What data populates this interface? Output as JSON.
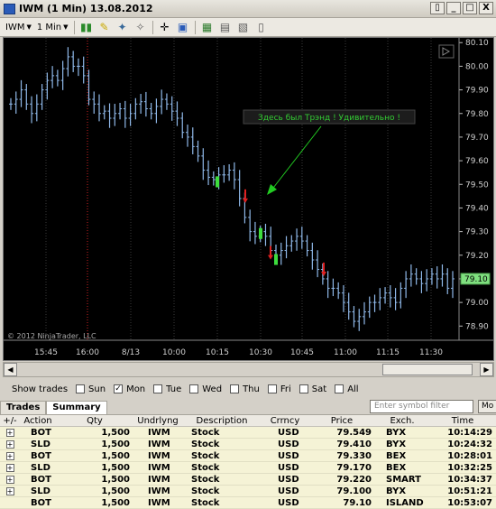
{
  "window": {
    "title": "IWM (1 Min)  13.08.2012",
    "btn_min": "_",
    "btn_max": "□",
    "btn_close": "X",
    "btn_restore": "▯"
  },
  "toolbar": {
    "instrument": "IWM",
    "interval": "1 Min",
    "icons": [
      "bars-icon",
      "pencil-icon",
      "drawing-tools-icon",
      "zoom-icon",
      "crosshair-icon",
      "magnifier-icon",
      "indicators-icon",
      "strategies-icon",
      "chart-properties-icon",
      "data-box-icon"
    ]
  },
  "chart": {
    "copyright": "© 2012 NinjaTrader, LLC",
    "annotation": "Здесь был Трэнд ! Удивительно !",
    "current_price": "79.10",
    "y_ticks": [
      "80.10",
      "80.00",
      "79.90",
      "79.80",
      "79.70",
      "79.60",
      "79.50",
      "79.40",
      "79.30",
      "79.20",
      "79.10",
      "79.00",
      "78.90"
    ],
    "x_ticks": [
      "15:45",
      "16:00",
      "8/13",
      "10:00",
      "10:15",
      "10:30",
      "10:45",
      "11:00",
      "11:15",
      "11:30"
    ],
    "colors": {
      "background": "#000000",
      "up_bar": "#8fb8e8",
      "down_bar": "#8fb8e8",
      "buy_marker": "#3ddc3d",
      "sell_marker": "#e02020",
      "annotation_text": "#33cc33",
      "arrow": "#22cc22",
      "session_break": "#cc2222"
    }
  },
  "chart_data": {
    "type": "ohlc",
    "instrument": "IWM",
    "interval": "1 Min",
    "y_range": [
      78.84,
      80.12
    ],
    "closes": [
      79.84,
      79.86,
      79.9,
      79.84,
      79.8,
      79.84,
      79.9,
      79.94,
      79.96,
      79.94,
      79.99,
      80.04,
      80.0,
      80.0,
      79.96,
      79.86,
      79.84,
      79.8,
      79.81,
      79.78,
      79.8,
      79.82,
      79.78,
      79.8,
      79.84,
      79.85,
      79.82,
      79.8,
      79.83,
      79.86,
      79.84,
      79.81,
      79.78,
      79.72,
      79.7,
      79.66,
      79.62,
      79.56,
      79.53,
      79.52,
      79.54,
      79.54,
      79.56,
      79.52,
      79.44,
      79.36,
      79.3,
      79.28,
      79.3,
      79.28,
      79.22,
      79.2,
      79.22,
      79.24,
      79.26,
      79.28,
      79.26,
      79.22,
      79.18,
      79.14,
      79.1,
      79.06,
      79.06,
      79.04,
      79.0,
      78.96,
      78.92,
      78.94,
      78.96,
      79.0,
      79.0,
      79.02,
      79.04,
      79.02,
      79.0,
      79.06,
      79.1,
      79.12,
      79.1,
      79.08,
      79.1,
      79.12,
      79.1,
      79.12,
      79.06,
      79.1
    ],
    "trades": [
      {
        "action": "BOT",
        "price": 79.549,
        "time": "10:14:29"
      },
      {
        "action": "SLD",
        "price": 79.41,
        "time": "10:24:32"
      },
      {
        "action": "BOT",
        "price": 79.33,
        "time": "10:28:01"
      },
      {
        "action": "SLD",
        "price": 79.17,
        "time": "10:32:25"
      },
      {
        "action": "BOT",
        "price": 79.22,
        "time": "10:34:37"
      },
      {
        "action": "SLD",
        "price": 79.1,
        "time": "10:51:21"
      }
    ]
  },
  "show_trades": {
    "label": "Show trades",
    "days": [
      {
        "name": "Sun",
        "checked": false
      },
      {
        "name": "Mon",
        "checked": true
      },
      {
        "name": "Tue",
        "checked": false
      },
      {
        "name": "Wed",
        "checked": false
      },
      {
        "name": "Thu",
        "checked": false
      },
      {
        "name": "Fri",
        "checked": false
      },
      {
        "name": "Sat",
        "checked": false
      },
      {
        "name": "All",
        "checked": false
      }
    ]
  },
  "tabs": [
    {
      "label": "Trades"
    },
    {
      "label": "Summary"
    }
  ],
  "filter": {
    "placeholder": "Enter symbol filter"
  },
  "more_button": "Mo",
  "grid": {
    "headers": [
      "+/-",
      "Action",
      "Qty",
      "Undrlyng",
      "Description",
      "Crrncy",
      "Price",
      "Exch.",
      "Time"
    ],
    "rows": [
      {
        "expand": "+",
        "action": "BOT",
        "qty": "1,500",
        "und": "IWM",
        "desc": "Stock",
        "cur": "USD",
        "price": "79.549",
        "exch": "BYX",
        "time": "10:14:29"
      },
      {
        "expand": "+",
        "action": "SLD",
        "qty": "1,500",
        "und": "IWM",
        "desc": "Stock",
        "cur": "USD",
        "price": "79.410",
        "exch": "BYX",
        "time": "10:24:32"
      },
      {
        "expand": "+",
        "action": "BOT",
        "qty": "1,500",
        "und": "IWM",
        "desc": "Stock",
        "cur": "USD",
        "price": "79.330",
        "exch": "BEX",
        "time": "10:28:01"
      },
      {
        "expand": "+",
        "action": "SLD",
        "qty": "1,500",
        "und": "IWM",
        "desc": "Stock",
        "cur": "USD",
        "price": "79.170",
        "exch": "BEX",
        "time": "10:32:25"
      },
      {
        "expand": "+",
        "action": "BOT",
        "qty": "1,500",
        "und": "IWM",
        "desc": "Stock",
        "cur": "USD",
        "price": "79.220",
        "exch": "SMART",
        "time": "10:34:37"
      },
      {
        "expand": "+",
        "action": "SLD",
        "qty": "1,500",
        "und": "IWM",
        "desc": "Stock",
        "cur": "USD",
        "price": "79.100",
        "exch": "BYX",
        "time": "10:51:21"
      },
      {
        "expand": "",
        "action": "BOT",
        "qty": "1,500",
        "und": "IWM",
        "desc": "Stock",
        "cur": "USD",
        "price": "79.10",
        "exch": "ISLAND",
        "time": "10:53:07"
      }
    ]
  }
}
